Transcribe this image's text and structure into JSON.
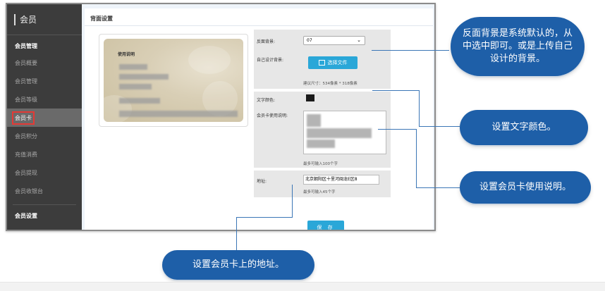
{
  "sidebar": {
    "header": "会员",
    "groups": [
      {
        "title": "会员管理",
        "items": [
          "会员概要",
          "会员管理",
          "会员等级",
          "会员卡",
          "会员积分",
          "充值消费",
          "会员提现",
          "会员收银台"
        ]
      },
      {
        "title": "会员设置",
        "items": [
          "会员设置"
        ]
      }
    ],
    "active": "会员卡"
  },
  "content": {
    "title": "背面设置",
    "card": {
      "title": "使用说明"
    },
    "form": {
      "bg_label": "反面背景:",
      "bg_value": "07",
      "custom_bg_label": "自己设计背景:",
      "upload_label": "选择文件",
      "size_hint": "建议尺寸：534像素 * 318像素",
      "text_color_label": "文字颜色:",
      "text_color": "#1a1a1a",
      "usage_label": "会员卡使用说明:",
      "usage_hint": "最多可输入100个字",
      "address_label": "地址:",
      "address_value": "北京朝阳区十里河闽龙E区8",
      "address_hint": "最多可输入45个字"
    },
    "save_label": "保 存"
  },
  "callouts": {
    "background": "反面背景是系统默认的，从中选中即可。或是上传自己设计的背景。",
    "text_color": "设置文字颜色。",
    "usage": "设置会员卡使用说明。",
    "address": "设置会员卡上的地址。"
  },
  "colors": {
    "accent": "#2aa7d8",
    "callout": "#1e5fa8",
    "sidebar": "#3c3c3c"
  }
}
